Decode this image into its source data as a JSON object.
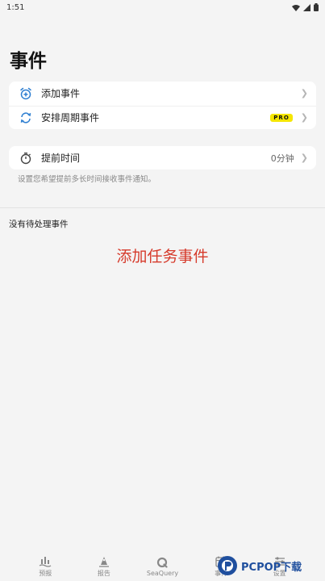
{
  "status_bar": {
    "time": "1:51"
  },
  "page": {
    "title": "事件"
  },
  "event_card": {
    "items": [
      {
        "label": "添加事件",
        "icon": "alarm-add-icon"
      },
      {
        "label": "安排周期事件",
        "icon": "recurring-icon",
        "badge": "PRO"
      }
    ]
  },
  "advance_card": {
    "label": "提前时间",
    "value": "0分钟",
    "icon": "stopwatch-icon"
  },
  "hint": "设置您希望提前多长时间接收事件通知。",
  "pending": {
    "label": "没有待处理事件"
  },
  "overlay_caption": "添加任务事件",
  "tabs": [
    {
      "label": "预报",
      "icon": "forecast-icon"
    },
    {
      "label": "报告",
      "icon": "report-icon"
    },
    {
      "label": "SeaQuery",
      "icon": "seaquery-icon"
    },
    {
      "label": "事件",
      "icon": "events-icon"
    },
    {
      "label": "设置",
      "icon": "settings-icon"
    }
  ],
  "watermark": {
    "text": "PCPOP下载"
  },
  "colors": {
    "accent": "#2f7fd1",
    "pro_badge": "#f5e600",
    "caption": "#d63a2b"
  }
}
